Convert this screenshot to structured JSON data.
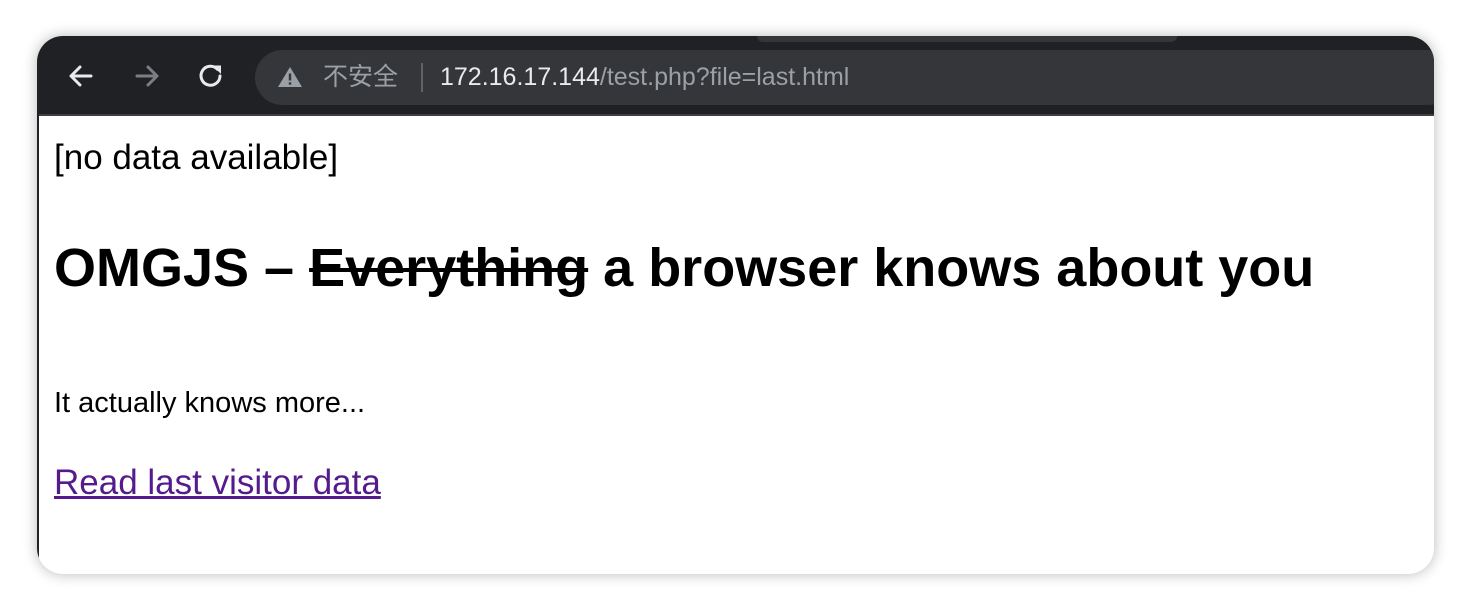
{
  "browser": {
    "security_label": "不安全",
    "url_host": "172.16.17.144",
    "url_path": "/test.php?file=last.html",
    "icons": {
      "back": "back-arrow-icon",
      "forward": "forward-arrow-icon",
      "reload": "reload-icon",
      "security": "warning-triangle-icon"
    }
  },
  "page": {
    "status_text": "[no data available]",
    "heading_prefix": "OMGJS – ",
    "heading_strike": "Everything",
    "heading_suffix": " a browser knows about you",
    "subtext": "It actually knows more...",
    "link_text": "Read last visitor data",
    "link_color": "#551a8b"
  }
}
